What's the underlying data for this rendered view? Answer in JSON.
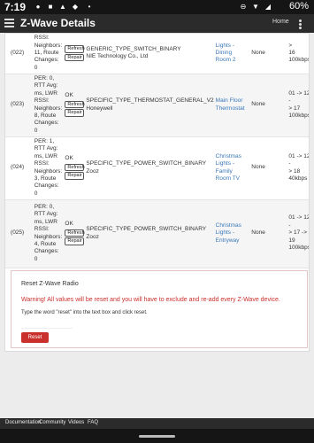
{
  "statusbar": {
    "time": "7:19",
    "battery": "60%"
  },
  "appbar": {
    "title": "Z-Wave Details",
    "home_link": "Home"
  },
  "buttons": {
    "refresh": "Refresh",
    "repair": "Repair"
  },
  "devices": [
    {
      "id": "(022)",
      "stats": [
        "RSSI:",
        "Neighbors:",
        "11, Route",
        "Changes:",
        "0"
      ],
      "status": "",
      "type": "GENERIC_TYPE_SWITCH_BINARY",
      "manufacturer": "NIE Technology Co., Ltd",
      "name": [
        "Lights -",
        "Dining",
        "Room 2"
      ],
      "security": "None",
      "route": [
        ">",
        "16",
        "100kbps"
      ]
    },
    {
      "id": "(023)",
      "stats": [
        "PER: 0,",
        "RTT Avg:",
        "ms, LWR",
        "RSSI:",
        "Neighbors:",
        "8, Route",
        "Changes:",
        "0"
      ],
      "status": "OK",
      "type": "SPECIFIC_TYPE_THERMOSTAT_GENERAL_V2",
      "manufacturer": "Honeywell",
      "name": [
        "Main Floor",
        "Thermostat"
      ],
      "security": "None",
      "route": [
        "01 -> 12 -",
        "> 17",
        "100kbps"
      ]
    },
    {
      "id": "(024)",
      "stats": [
        "PER: 1,",
        "RTT Avg:",
        "ms, LWR",
        "RSSI:",
        "Neighbors:",
        "3, Route",
        "Changes:",
        "0"
      ],
      "status": "OK",
      "type": "SPECIFIC_TYPE_POWER_SWITCH_BINARY",
      "manufacturer": "Zooz",
      "name": [
        "Christmas",
        "Lights -",
        "Family",
        "Room TV"
      ],
      "security": "None",
      "route": [
        "01 -> 12 -",
        "> 18",
        "40kbps"
      ]
    },
    {
      "id": "(025)",
      "stats": [
        "PER: 0,",
        "RTT Avg:",
        "ms, LWR",
        "RSSI:",
        "Neighbors:",
        "4, Route",
        "Changes:",
        "0"
      ],
      "status": "OK",
      "type": "SPECIFIC_TYPE_POWER_SWITCH_BINARY",
      "manufacturer": "Zooz",
      "name": [
        "Christmas",
        "Lights -",
        "Entryway"
      ],
      "security": "None",
      "route": [
        "01 -> 12 -",
        "> 17 ->",
        "19",
        "100kbps"
      ]
    }
  ],
  "reset": {
    "title": "Reset Z-Wave Radio",
    "warning": "Warning! All values will be reset and you will have to exclude and re-add every Z-Wave device.",
    "instruction": "Type the word \"reset\" into the text box and click reset.",
    "button": "Reset"
  },
  "footer": {
    "links": [
      "Documentation",
      "Community",
      "Videos",
      "FAQ"
    ]
  }
}
